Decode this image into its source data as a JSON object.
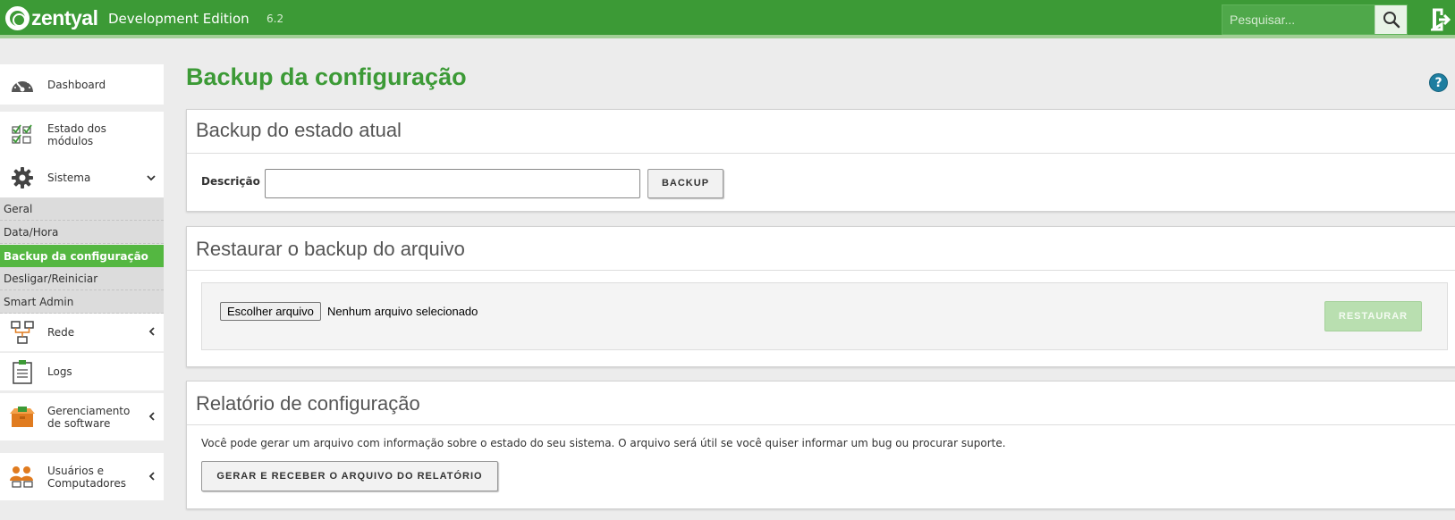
{
  "header": {
    "logo_text": "zentyal",
    "edition": "Development Edition",
    "version": "6.2",
    "search_placeholder": "Pesquisar...",
    "icons": {
      "search": "search-icon",
      "logout": "logout-icon"
    }
  },
  "sidebar": {
    "items": [
      {
        "label": "Dashboard",
        "icon": "speedometer-icon"
      },
      {
        "label": "Estado dos módulos",
        "icon": "checklist-icon"
      },
      {
        "label": "Sistema",
        "icon": "gear-icon",
        "chevron": "chevron-down-icon"
      },
      {
        "label": "Rede",
        "icon": "network-icon",
        "chevron": "chevron-left-icon"
      },
      {
        "label": "Logs",
        "icon": "clipboard-icon"
      },
      {
        "label": "Gerenciamento de software",
        "icon": "package-icon",
        "chevron": "chevron-left-icon"
      },
      {
        "label": "Usuários e Computadores",
        "icon": "users-icon",
        "chevron": "chevron-left-icon"
      }
    ],
    "subitems": [
      {
        "label": "Geral",
        "active": false
      },
      {
        "label": "Data/Hora",
        "active": false
      },
      {
        "label": "Backup da configuração",
        "active": true
      },
      {
        "label": "Desligar/Reiniciar",
        "active": false
      },
      {
        "label": "Smart Admin",
        "active": false
      }
    ]
  },
  "main": {
    "title": "Backup da configuração",
    "help": "?",
    "backup_panel": {
      "title": "Backup do estado atual",
      "description_label": "Descrição",
      "description_value": "",
      "button": "BACKUP"
    },
    "restore_panel": {
      "title": "Restaurar o backup do arquivo",
      "choose_file": "Escolher arquivo",
      "no_file": "Nenhum arquivo selecionado",
      "button": "RESTAURAR"
    },
    "report_panel": {
      "title": "Relatório de configuração",
      "text": "Você pode gerar um arquivo com informação sobre o estado do seu sistema. O arquivo será útil se você quiser informar um bug ou procurar suporte.",
      "button": "GERAR E RECEBER O ARQUIVO DO RELATÓRIO"
    }
  },
  "colors": {
    "brand_green": "#3c9a36",
    "active_green": "#54b741",
    "help_blue": "#1e7ea0"
  }
}
